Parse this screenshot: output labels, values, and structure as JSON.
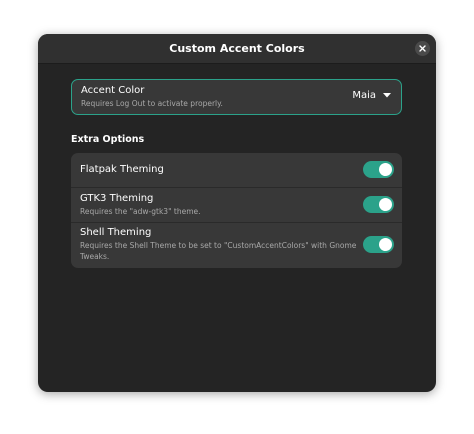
{
  "window": {
    "title": "Custom Accent Colors",
    "close_icon": "close-icon"
  },
  "accent_color": {
    "title": "Accent Color",
    "subtitle": "Requires Log Out to activate properly.",
    "selected_value": "Maia",
    "dropdown_icon": "chevron-down-icon"
  },
  "extra_options": {
    "heading": "Extra Options",
    "rows": [
      {
        "title": "Flatpak Theming",
        "subtitle": "",
        "enabled": true
      },
      {
        "title": "GTK3 Theming",
        "subtitle": "Requires the \"adw-gtk3\" theme.",
        "enabled": true
      },
      {
        "title": "Shell Theming",
        "subtitle_line1": "Requires the Shell Theme to be set to \"CustomAccentColors\" with Gnome",
        "subtitle_line2": "Tweaks.",
        "enabled": true
      }
    ]
  },
  "colors": {
    "accent": "#2ba28a",
    "window_bg": "#242424",
    "card_bg": "#383838"
  }
}
